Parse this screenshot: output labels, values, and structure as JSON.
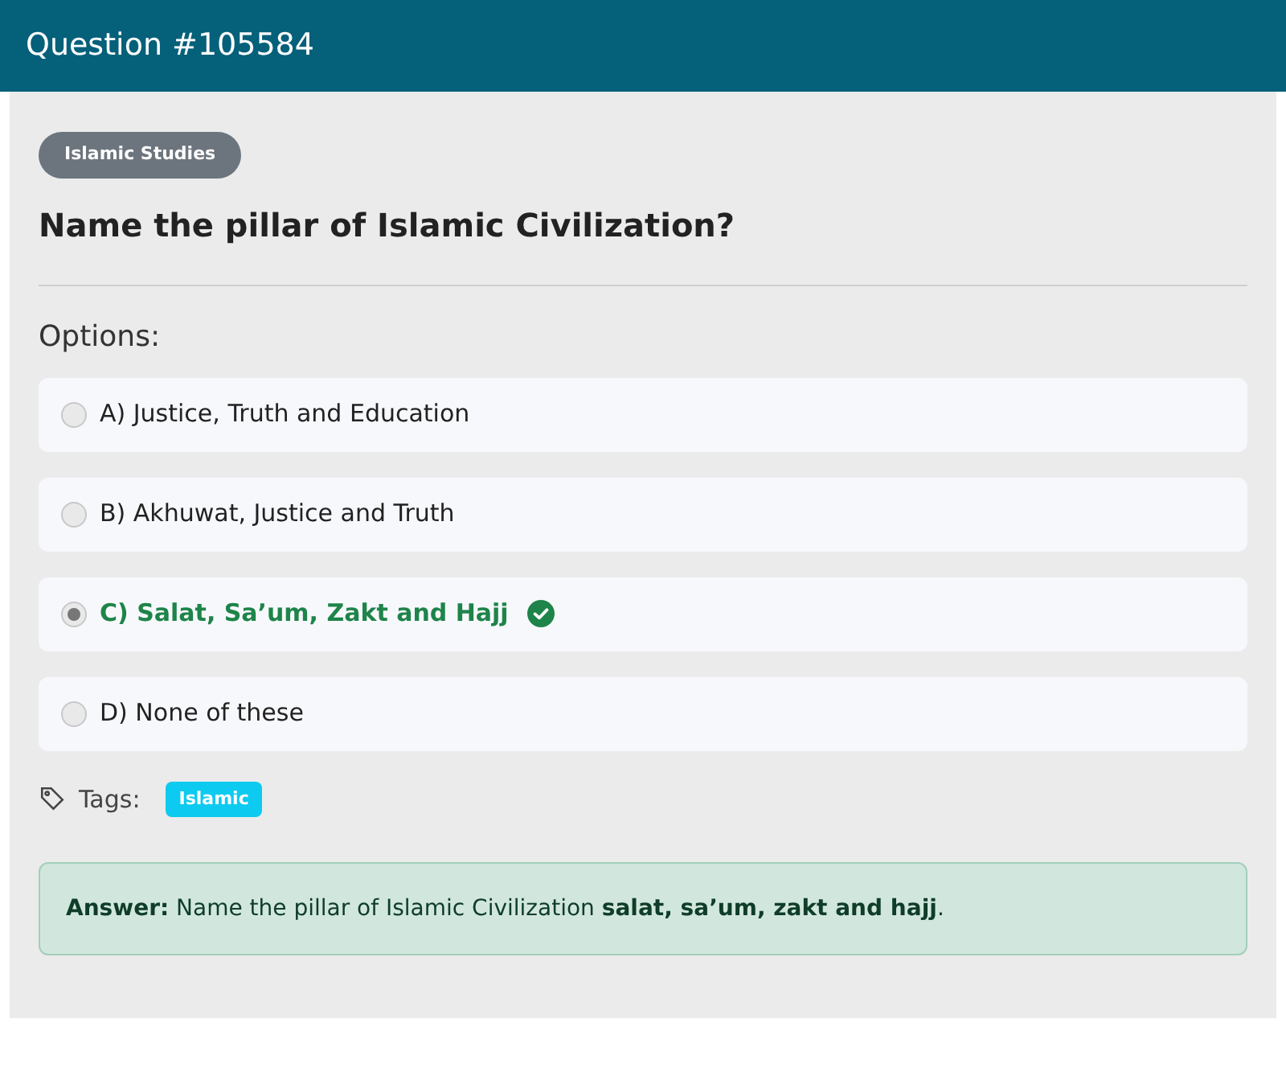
{
  "header": {
    "title": "Question #105584"
  },
  "category": "Islamic Studies",
  "question": "Name the pillar of Islamic Civilization?",
  "options_label": "Options:",
  "options": [
    {
      "text": "A) Justice, Truth and Education",
      "selected": false,
      "correct": false
    },
    {
      "text": "B) Akhuwat, Justice and Truth",
      "selected": false,
      "correct": false
    },
    {
      "text": "C) Salat, Sa’um, Zakt and Hajj",
      "selected": true,
      "correct": true
    },
    {
      "text": "D) None of these",
      "selected": false,
      "correct": false
    }
  ],
  "tags_label": "Tags:",
  "tags": [
    "Islamic"
  ],
  "answer": "**Answer:** Name the pillar of Islamic Civilization **salat, sa’um, zakt and hajj**."
}
